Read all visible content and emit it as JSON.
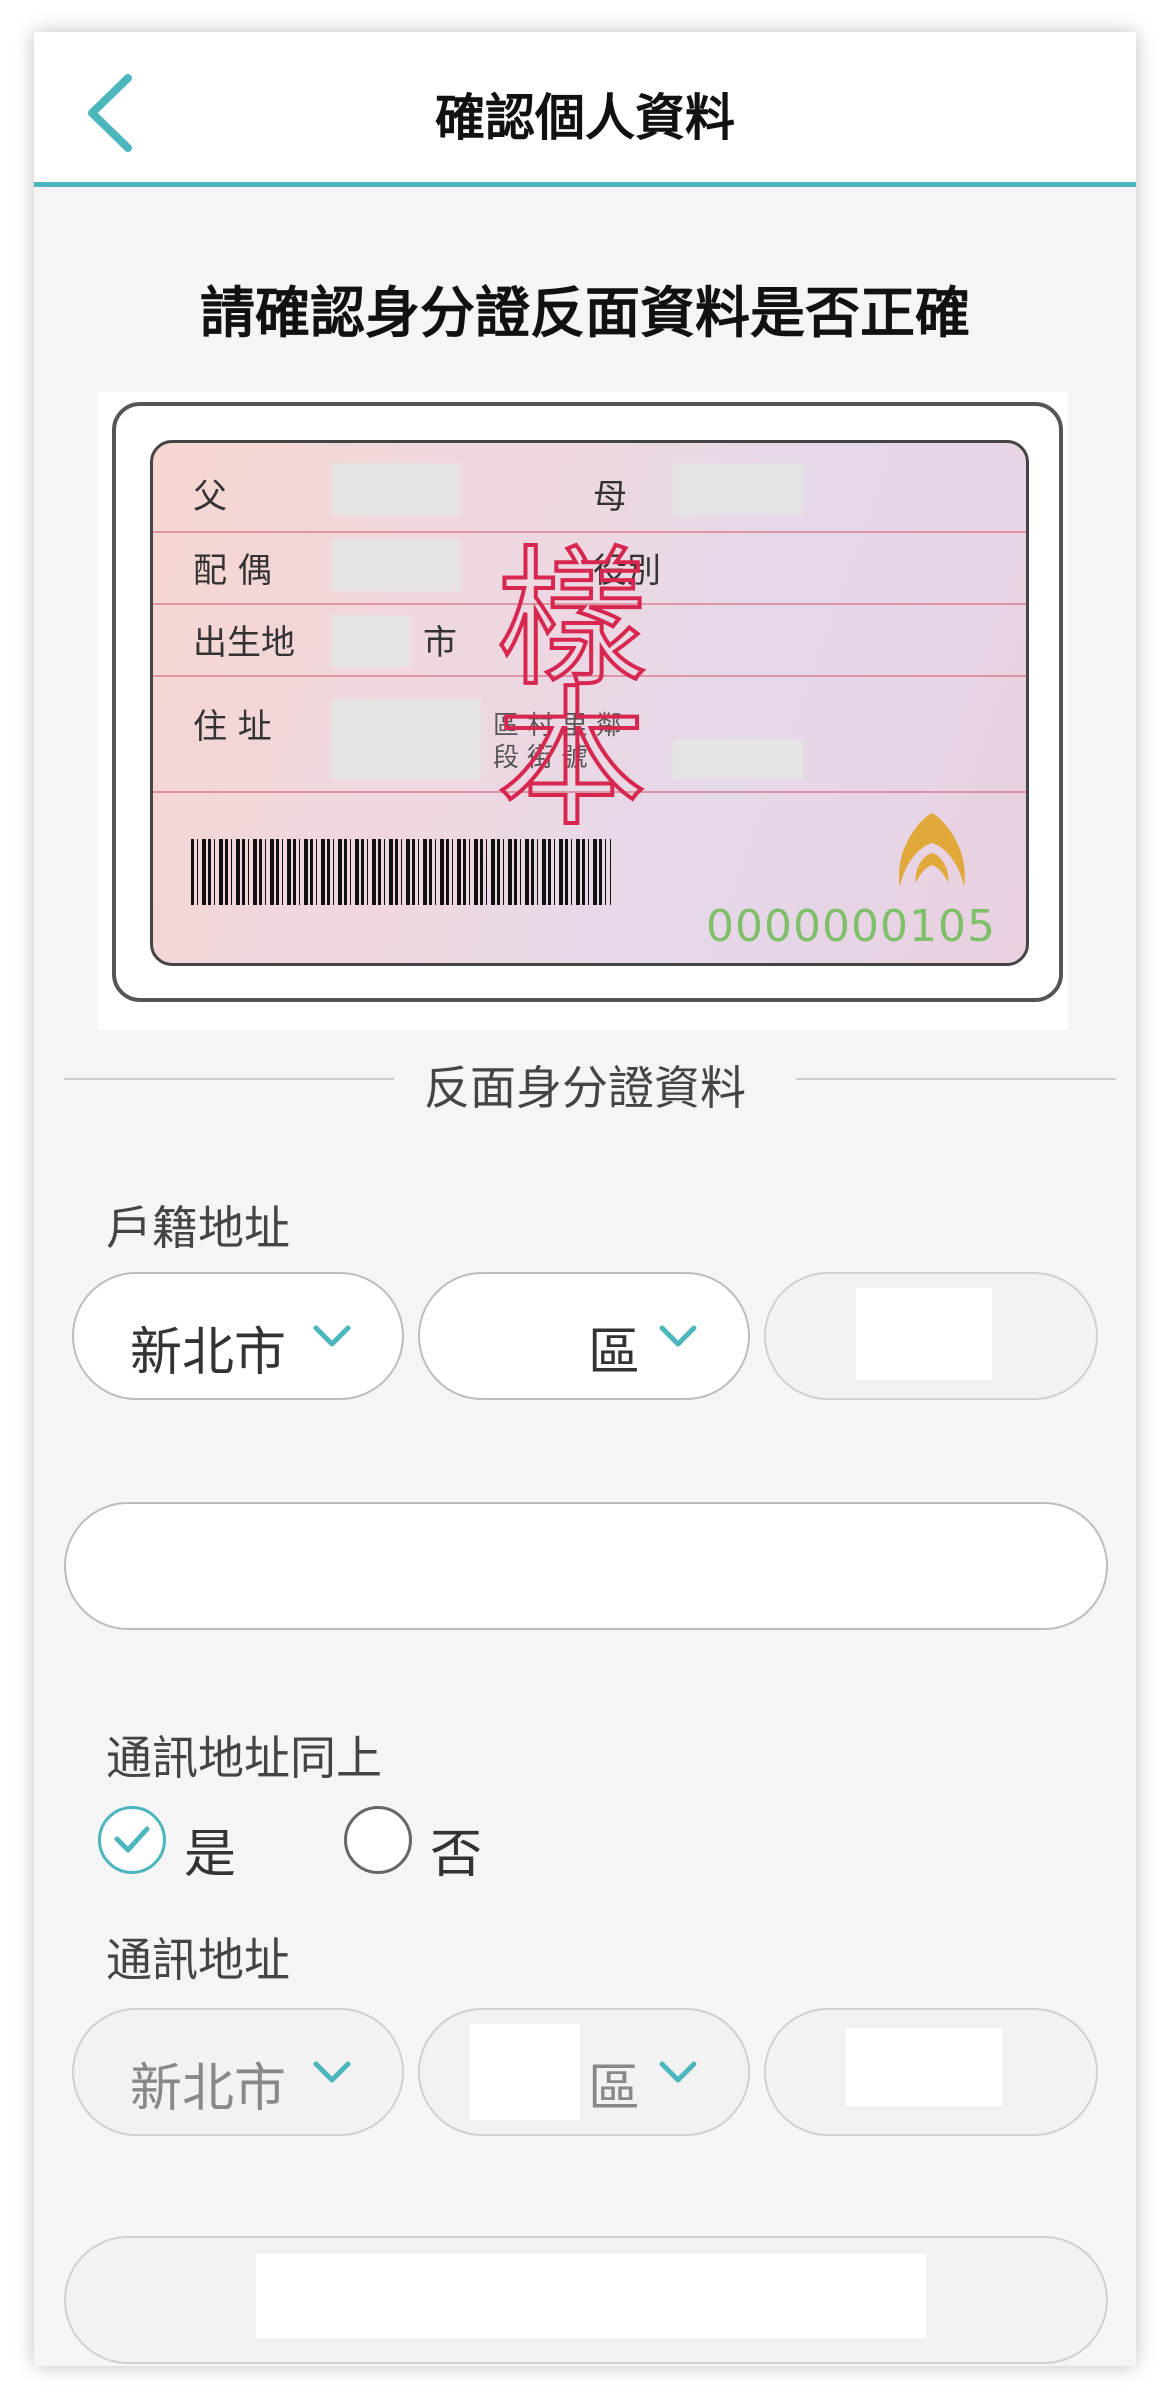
{
  "header": {
    "title": "確認個人資料"
  },
  "page_heading": "請確認身分證反面資料是否正確",
  "id_card": {
    "labels": {
      "father": "父",
      "mother": "母",
      "spouse": "配 偶",
      "military": "役別",
      "birthplace": "出生地",
      "city_suffix": "市",
      "address": "住 址",
      "addr_line1": "區 村 里 鄰",
      "addr_line2": "段 街 號"
    },
    "stamp": "樣本",
    "serial": "0000000105",
    "accent_color": "#d8274f",
    "serial_color": "#7fbf6a"
  },
  "section_title": "反面身分證資料",
  "household_address": {
    "label": "戶籍地址",
    "city": "新北市",
    "district_suffix": "區"
  },
  "mailing_same": {
    "label": "通訊地址同上",
    "yes_label": "是",
    "no_label": "否",
    "selected": "是"
  },
  "mailing_address": {
    "label": "通訊地址",
    "city": "新北市",
    "district_suffix": "區"
  },
  "colors": {
    "accent": "#4db6bd"
  }
}
